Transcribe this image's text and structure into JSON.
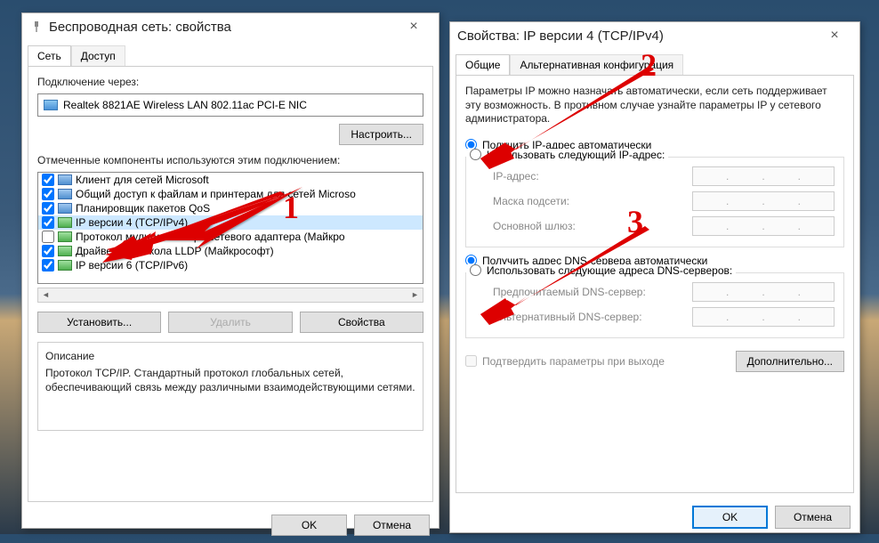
{
  "win1": {
    "title": "Беспроводная сеть: свойства",
    "tabs": [
      "Сеть",
      "Доступ"
    ],
    "connect_via_label": "Подключение через:",
    "adapter": "Realtek 8821AE Wireless LAN 802.11ac PCI-E NIC",
    "configure_btn": "Настроить...",
    "components_label": "Отмеченные компоненты используются этим подключением:",
    "components": [
      {
        "checked": true,
        "icon": "blue",
        "label": "Клиент для сетей Microsoft"
      },
      {
        "checked": true,
        "icon": "blue",
        "label": "Общий доступ к файлам и принтерам для сетей Microso"
      },
      {
        "checked": true,
        "icon": "blue",
        "label": "Планировщик пакетов QoS"
      },
      {
        "checked": true,
        "icon": "green",
        "label": "IP версии 4 (TCP/IPv4)",
        "selected": true
      },
      {
        "checked": false,
        "icon": "green",
        "label": "Протокол мультиплексора сетевого адаптера (Майкро"
      },
      {
        "checked": true,
        "icon": "green",
        "label": "Драйвер протокола LLDP (Майкрософт)"
      },
      {
        "checked": true,
        "icon": "green",
        "label": "IP версии 6 (TCP/IPv6)"
      }
    ],
    "install_btn": "Установить...",
    "delete_btn": "Удалить",
    "props_btn": "Свойства",
    "desc_title": "Описание",
    "desc_text": "Протокол TCP/IP. Стандартный протокол глобальных сетей, обеспечивающий связь между различными взаимодействующими сетями.",
    "ok_btn": "OK",
    "cancel_btn": "Отмена"
  },
  "win2": {
    "title": "Свойства: IP версии 4 (TCP/IPv4)",
    "tabs": [
      "Общие",
      "Альтернативная конфигурация"
    ],
    "info": "Параметры IP можно назначать автоматически, если сеть поддерживает эту возможность. В противном случае узнайте параметры IP у сетевого администратора.",
    "radio_ip_auto": "Получить IP-адрес автоматически",
    "radio_ip_manual": "Использовать следующий IP-адрес:",
    "ip_address_label": "IP-адрес:",
    "mask_label": "Маска подсети:",
    "gateway_label": "Основной шлюз:",
    "radio_dns_auto": "Получить адрес DNS-сервера автоматически",
    "radio_dns_manual": "Использовать следующие адреса DNS-серверов:",
    "dns_pref_label": "Предпочитаемый DNS-сервер:",
    "dns_alt_label": "Альтернативный DNS-сервер:",
    "validate_label": "Подтвердить параметры при выходе",
    "advanced_btn": "Дополнительно...",
    "ok_btn": "OK",
    "cancel_btn": "Отмена"
  },
  "annotations": {
    "one": "1",
    "two": "2",
    "three": "3"
  }
}
